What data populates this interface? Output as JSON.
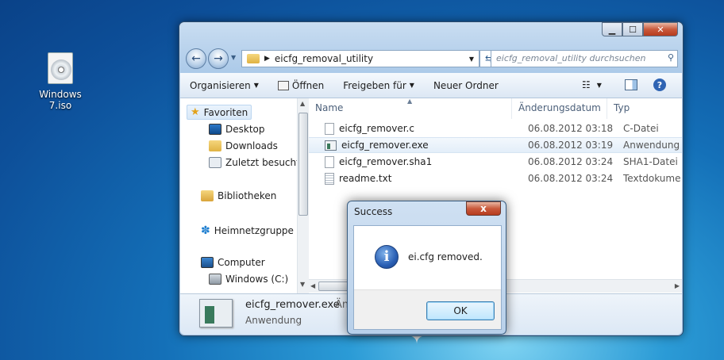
{
  "desktop": {
    "iso_label": "Windows 7.iso"
  },
  "window": {
    "address": "eicfg_removal_utility",
    "search_placeholder": "eicfg_removal_utility durchsuchen"
  },
  "toolbar": {
    "organize": "Organisieren",
    "open": "Öffnen",
    "share": "Freigeben für",
    "new_folder": "Neuer Ordner"
  },
  "nav": {
    "favorites": "Favoriten",
    "desktop": "Desktop",
    "downloads": "Downloads",
    "recent": "Zuletzt besucht",
    "libraries": "Bibliotheken",
    "homegroup": "Heimnetzgruppe",
    "computer": "Computer",
    "drive_c": "Windows (C:)"
  },
  "columns": {
    "name": "Name",
    "date": "Änderungsdatum",
    "type": "Typ"
  },
  "files": [
    {
      "name": "eicfg_remover.c",
      "date": "06.08.2012 03:18",
      "type": "C-Datei"
    },
    {
      "name": "eicfg_remover.exe",
      "date": "06.08.2012 03:19",
      "type": "Anwendung"
    },
    {
      "name": "eicfg_remover.sha1",
      "date": "06.08.2012 03:24",
      "type": "SHA1-Datei"
    },
    {
      "name": "readme.txt",
      "date": "06.08.2012 03:24",
      "type": "Textdokume"
    }
  ],
  "details": {
    "name": "eicfg_remover.exe",
    "type": "Anwendung",
    "extra": "Änd"
  },
  "dialog": {
    "title": "Success",
    "message": "ei.cfg removed.",
    "ok": "OK",
    "close": "x"
  }
}
